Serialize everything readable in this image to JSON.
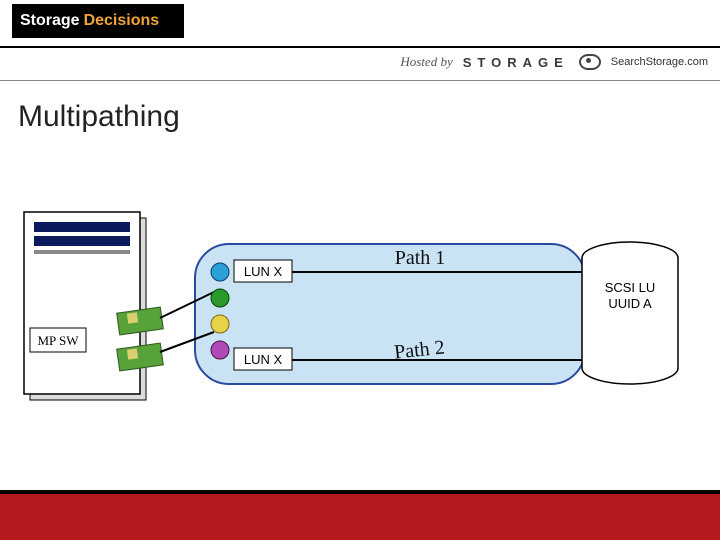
{
  "brand": {
    "left": "Storage",
    "right": "Decisions"
  },
  "hosted": {
    "label": "Hosted by",
    "storage": "STORAGE",
    "search": "SearchStorage.com"
  },
  "title": "Multipathing",
  "diagram": {
    "mp_sw": "MP SW",
    "lun1": "LUN X",
    "lun2": "LUN X",
    "path1": "Path 1",
    "path2": "Path 2",
    "disk_line1": "SCSI LU",
    "disk_line2": "UUID A"
  }
}
